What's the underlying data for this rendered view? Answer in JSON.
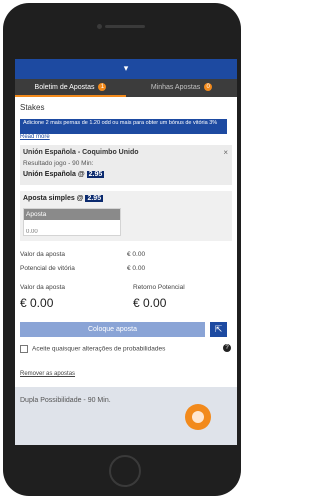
{
  "tabs": [
    {
      "label": "Boletim de Apostas",
      "badge": "1"
    },
    {
      "label": "Minhas Apostas",
      "badge": "0"
    }
  ],
  "topbar": {
    "icon": "chevron-down-icon",
    "glyph": "▾"
  },
  "stakes_title": "Stakes",
  "banner": {
    "text": "Adicione 2 mais pernas de 1.20 odd ou mais para obter um bónus de vitória 3%",
    "readmore": "Read more"
  },
  "selection": {
    "match": "Unión Española - Coquimbo Unido",
    "close": "×",
    "market": "Resultado jogo - 90 Min:",
    "pick": "Unión Española @",
    "odd": "2.95"
  },
  "simple": {
    "title": "Aposta simples @",
    "odd": "2.95",
    "stake_label": "Aposta",
    "stake_placeholder": "0.00"
  },
  "summary": {
    "valor_label": "Valor da aposta",
    "valor_value": "€ 0.00",
    "potencial_label": "Potencial de vitória",
    "potencial_value": "€ 0.00",
    "valor2_label": "Valor da aposta",
    "retorno_label": "Retorno Potencial",
    "valor2_value": "€ 0.00",
    "retorno_value": "€ 0.00"
  },
  "place_button": "Coloque aposta",
  "share_glyph": "⇱",
  "accept_label": "Aceite quaisquer alterações de probabilidades",
  "help_glyph": "?",
  "remove_link": "Remover as apostas",
  "background_text": "Dupla Possibilidade - 90 Min.",
  "colors": {
    "primary": "#1d4aa1",
    "accent": "#f28a1c",
    "odd_bg": "#0b2a6e"
  }
}
